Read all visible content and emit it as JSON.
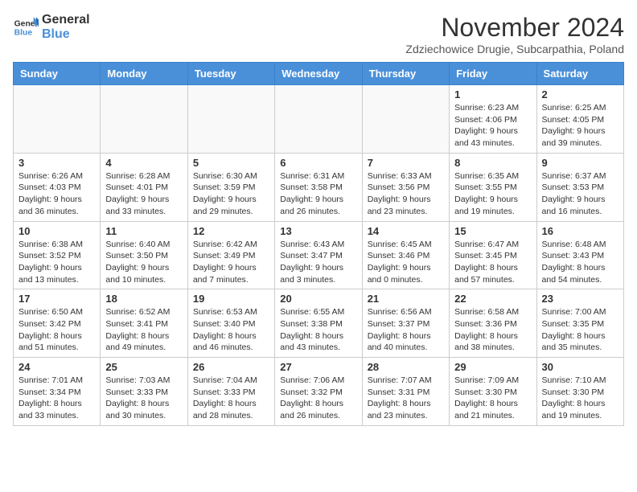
{
  "header": {
    "logo_line1": "General",
    "logo_line2": "Blue",
    "month_title": "November 2024",
    "location": "Zdziechowice Drugie, Subcarpathia, Poland"
  },
  "days_of_week": [
    "Sunday",
    "Monday",
    "Tuesday",
    "Wednesday",
    "Thursday",
    "Friday",
    "Saturday"
  ],
  "weeks": [
    [
      {
        "day": "",
        "info": ""
      },
      {
        "day": "",
        "info": ""
      },
      {
        "day": "",
        "info": ""
      },
      {
        "day": "",
        "info": ""
      },
      {
        "day": "",
        "info": ""
      },
      {
        "day": "1",
        "info": "Sunrise: 6:23 AM\nSunset: 4:06 PM\nDaylight: 9 hours and 43 minutes."
      },
      {
        "day": "2",
        "info": "Sunrise: 6:25 AM\nSunset: 4:05 PM\nDaylight: 9 hours and 39 minutes."
      }
    ],
    [
      {
        "day": "3",
        "info": "Sunrise: 6:26 AM\nSunset: 4:03 PM\nDaylight: 9 hours and 36 minutes."
      },
      {
        "day": "4",
        "info": "Sunrise: 6:28 AM\nSunset: 4:01 PM\nDaylight: 9 hours and 33 minutes."
      },
      {
        "day": "5",
        "info": "Sunrise: 6:30 AM\nSunset: 3:59 PM\nDaylight: 9 hours and 29 minutes."
      },
      {
        "day": "6",
        "info": "Sunrise: 6:31 AM\nSunset: 3:58 PM\nDaylight: 9 hours and 26 minutes."
      },
      {
        "day": "7",
        "info": "Sunrise: 6:33 AM\nSunset: 3:56 PM\nDaylight: 9 hours and 23 minutes."
      },
      {
        "day": "8",
        "info": "Sunrise: 6:35 AM\nSunset: 3:55 PM\nDaylight: 9 hours and 19 minutes."
      },
      {
        "day": "9",
        "info": "Sunrise: 6:37 AM\nSunset: 3:53 PM\nDaylight: 9 hours and 16 minutes."
      }
    ],
    [
      {
        "day": "10",
        "info": "Sunrise: 6:38 AM\nSunset: 3:52 PM\nDaylight: 9 hours and 13 minutes."
      },
      {
        "day": "11",
        "info": "Sunrise: 6:40 AM\nSunset: 3:50 PM\nDaylight: 9 hours and 10 minutes."
      },
      {
        "day": "12",
        "info": "Sunrise: 6:42 AM\nSunset: 3:49 PM\nDaylight: 9 hours and 7 minutes."
      },
      {
        "day": "13",
        "info": "Sunrise: 6:43 AM\nSunset: 3:47 PM\nDaylight: 9 hours and 3 minutes."
      },
      {
        "day": "14",
        "info": "Sunrise: 6:45 AM\nSunset: 3:46 PM\nDaylight: 9 hours and 0 minutes."
      },
      {
        "day": "15",
        "info": "Sunrise: 6:47 AM\nSunset: 3:45 PM\nDaylight: 8 hours and 57 minutes."
      },
      {
        "day": "16",
        "info": "Sunrise: 6:48 AM\nSunset: 3:43 PM\nDaylight: 8 hours and 54 minutes."
      }
    ],
    [
      {
        "day": "17",
        "info": "Sunrise: 6:50 AM\nSunset: 3:42 PM\nDaylight: 8 hours and 51 minutes."
      },
      {
        "day": "18",
        "info": "Sunrise: 6:52 AM\nSunset: 3:41 PM\nDaylight: 8 hours and 49 minutes."
      },
      {
        "day": "19",
        "info": "Sunrise: 6:53 AM\nSunset: 3:40 PM\nDaylight: 8 hours and 46 minutes."
      },
      {
        "day": "20",
        "info": "Sunrise: 6:55 AM\nSunset: 3:38 PM\nDaylight: 8 hours and 43 minutes."
      },
      {
        "day": "21",
        "info": "Sunrise: 6:56 AM\nSunset: 3:37 PM\nDaylight: 8 hours and 40 minutes."
      },
      {
        "day": "22",
        "info": "Sunrise: 6:58 AM\nSunset: 3:36 PM\nDaylight: 8 hours and 38 minutes."
      },
      {
        "day": "23",
        "info": "Sunrise: 7:00 AM\nSunset: 3:35 PM\nDaylight: 8 hours and 35 minutes."
      }
    ],
    [
      {
        "day": "24",
        "info": "Sunrise: 7:01 AM\nSunset: 3:34 PM\nDaylight: 8 hours and 33 minutes."
      },
      {
        "day": "25",
        "info": "Sunrise: 7:03 AM\nSunset: 3:33 PM\nDaylight: 8 hours and 30 minutes."
      },
      {
        "day": "26",
        "info": "Sunrise: 7:04 AM\nSunset: 3:33 PM\nDaylight: 8 hours and 28 minutes."
      },
      {
        "day": "27",
        "info": "Sunrise: 7:06 AM\nSunset: 3:32 PM\nDaylight: 8 hours and 26 minutes."
      },
      {
        "day": "28",
        "info": "Sunrise: 7:07 AM\nSunset: 3:31 PM\nDaylight: 8 hours and 23 minutes."
      },
      {
        "day": "29",
        "info": "Sunrise: 7:09 AM\nSunset: 3:30 PM\nDaylight: 8 hours and 21 minutes."
      },
      {
        "day": "30",
        "info": "Sunrise: 7:10 AM\nSunset: 3:30 PM\nDaylight: 8 hours and 19 minutes."
      }
    ]
  ]
}
